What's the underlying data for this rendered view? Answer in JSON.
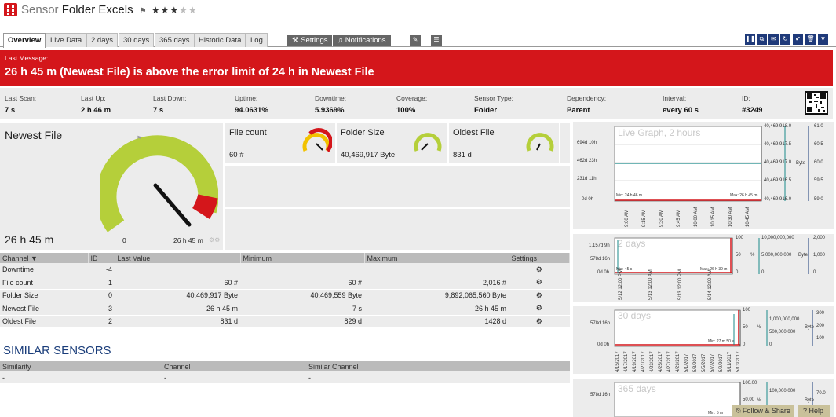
{
  "title": {
    "prefix": "Sensor",
    "name": "Folder Excels",
    "flag": "⚑",
    "stars_on": "★★★",
    "stars_off": "★★"
  },
  "tabs": [
    "Overview",
    "Live Data",
    "2 days",
    "30 days",
    "365 days",
    "Historic Data",
    "Log"
  ],
  "toolbar": {
    "settings": "Settings",
    "notifications": "Notifications"
  },
  "error": {
    "label": "Last Message:",
    "message": "26 h 45 m (Newest File) is above the error limit of 24 h in Newest File"
  },
  "stats": [
    {
      "label": "Last Scan:",
      "value": "7 s"
    },
    {
      "label": "Last Up:",
      "value": "2 h 46 m"
    },
    {
      "label": "Last Down:",
      "value": "7 s"
    },
    {
      "label": "Uptime:",
      "value": "94.0631%"
    },
    {
      "label": "Downtime:",
      "value": "5.9369%"
    },
    {
      "label": "Coverage:",
      "value": "100%"
    },
    {
      "label": "Sensor Type:",
      "value": "Folder"
    },
    {
      "label": "Dependency:",
      "value": "Parent"
    },
    {
      "label": "Interval:",
      "value": "every 60 s"
    },
    {
      "label": "ID:",
      "value": "#3249"
    }
  ],
  "gauges": {
    "newest": {
      "title": "Newest File",
      "value": "26 h 45 m",
      "min": "0",
      "max": "26 h 45 m",
      "level": 1.0
    },
    "count": {
      "title": "File count",
      "value": "60 #",
      "level": 0.85
    },
    "size": {
      "title": "Folder Size",
      "value": "40,469,917 Byte",
      "level": 0.8
    },
    "oldest": {
      "title": "Oldest File",
      "value": "831 d",
      "level": 0.75
    }
  },
  "channels": {
    "headers": [
      "Channel",
      "ID",
      "Last Value",
      "Minimum",
      "Maximum",
      "Settings"
    ],
    "rows": [
      {
        "name": "Downtime",
        "id": "-4",
        "last": "",
        "min": "",
        "max": ""
      },
      {
        "name": "File count",
        "id": "1",
        "last": "60 #",
        "min": "60 #",
        "max": "2,016 #"
      },
      {
        "name": "Folder Size",
        "id": "0",
        "last": "40,469,917 Byte",
        "min": "40,469,559 Byte",
        "max": "9,892,065,560 Byte"
      },
      {
        "name": "Newest File",
        "id": "3",
        "last": "26 h 45 m",
        "min": "7 s",
        "max": "26 h 45 m"
      },
      {
        "name": "Oldest File",
        "id": "2",
        "last": "831 d",
        "min": "829 d",
        "max": "1428 d"
      }
    ]
  },
  "similar": {
    "heading": "SIMILAR SENSORS",
    "headers": [
      "Similarity",
      "Channel",
      "Similar Channel"
    ],
    "row": [
      "-",
      "-",
      "-"
    ]
  },
  "graphs": [
    {
      "title": "Live Graph, 2 hours",
      "yleft": [
        "694d 10h",
        "462d 23h",
        "231d 11h",
        "0d 0h"
      ],
      "yright1": [
        "40,469,918.0",
        "40,469,917.5",
        "40,469,917.0",
        "40,469,916.5",
        "40,469,916.0"
      ],
      "yright2": [
        "61.0",
        "60.5",
        "60.0",
        "59.5",
        "59.0"
      ],
      "xticks": [
        "9:00 AM",
        "9:15 AM",
        "9:30 AM",
        "9:45 AM",
        "10:00 AM",
        "10:15 AM",
        "10:30 AM",
        "10:45 AM"
      ],
      "min": "Min: 24 h 46 m",
      "max": "Max: 26 h 45 m",
      "unit": "Byte",
      "unit2": "#"
    },
    {
      "title": "2 days",
      "yleft": [
        "1,157d 9h",
        "578d 16h",
        "0d 0h"
      ],
      "yright1": [
        "10,000,000,000",
        "5,000,000,000",
        "0"
      ],
      "yright2": [
        "2,000",
        "1,000",
        "0"
      ],
      "ypct": [
        "100",
        "50",
        "0"
      ],
      "xticks": [
        "5/12 12:00 PM",
        "5/13 12:00 AM",
        "5/13 12:00 PM",
        "5/14 12:00 AM"
      ],
      "min": "Min: 45 s",
      "max": "Max: 26 h 39 m",
      "unit": "Byte",
      "unit2": "%"
    },
    {
      "title": "30 days",
      "yleft": [
        "578d 16h",
        "0d 0h"
      ],
      "yright1": [
        "1,000,000,000",
        "500,000,000",
        "0"
      ],
      "yright2": [
        "300",
        "200",
        "100"
      ],
      "ypct": [
        "100",
        "50",
        "0"
      ],
      "xticks": [
        "4/15/2017",
        "4/17/2017",
        "4/19/2017",
        "4/21/2017",
        "4/23/2017",
        "4/25/2017",
        "4/27/2017",
        "4/29/2017",
        "5/1/2017",
        "5/3/2017",
        "5/5/2017",
        "5/7/2017",
        "5/9/2017",
        "5/11/2017",
        "5/13/2017"
      ],
      "min": "",
      "max": "Min: 27 m 50 s",
      "unit": "Byte",
      "unit2": "%"
    },
    {
      "title": "365 days",
      "yleft": [
        "578d 16h"
      ],
      "yright1": [
        "100,000,000"
      ],
      "yright2": [
        "70.0"
      ],
      "ypct": [
        "100.00",
        "50.00"
      ],
      "xticks": [],
      "min": "Min: 5 m",
      "max": "",
      "unit": "Byte",
      "unit2": "%"
    }
  ],
  "footer": {
    "follow": "Follow & Share",
    "help": "Help"
  }
}
